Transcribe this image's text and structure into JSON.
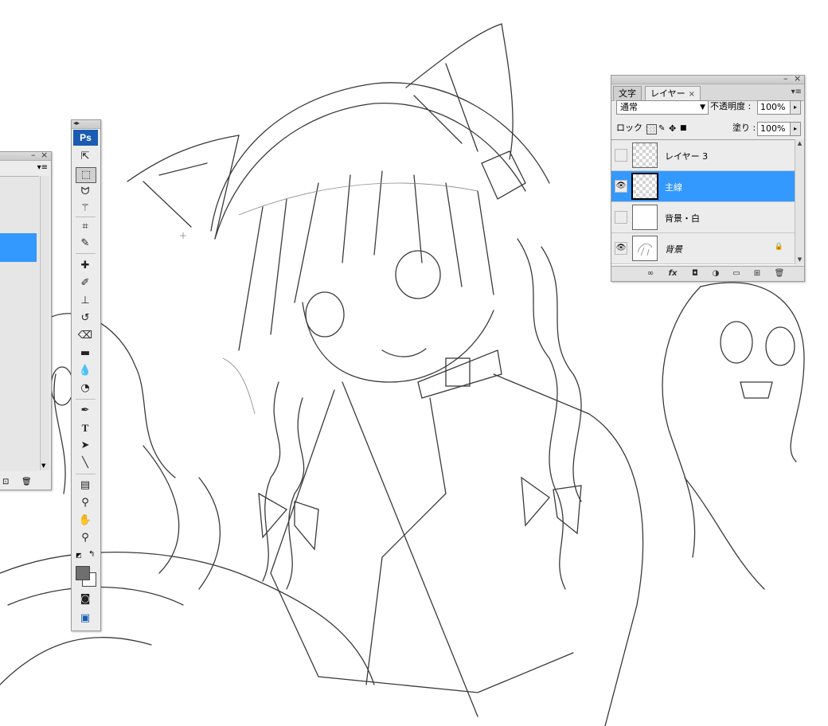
{
  "layers_panel": {
    "tabs": [
      "文字",
      "レイヤー"
    ],
    "active_tab": 1,
    "collapse_glyph": "«",
    "close_glyph": "×",
    "blend_mode": "通常",
    "opacity_label": "不透明度 :",
    "opacity_value": "100%",
    "lock_label": "ロック :",
    "fill_label": "塗り :",
    "fill_value": "100%",
    "layers": [
      {
        "name": "レイヤー 3",
        "visible": false,
        "selected": false,
        "thumb": "transparent"
      },
      {
        "name": "主線",
        "visible": true,
        "selected": true,
        "thumb": "transparent"
      },
      {
        "name": "背景・白",
        "visible": false,
        "selected": false,
        "thumb": "white"
      },
      {
        "name": "背景",
        "visible": true,
        "selected": false,
        "thumb": "sketch",
        "locked": true,
        "italic": true
      }
    ],
    "bottom_icons": [
      "link-icon",
      "fx-icon",
      "mask-icon",
      "adjustment-icon",
      "group-folder-icon",
      "new-layer-icon",
      "trash-icon"
    ],
    "fx_label": "fx"
  },
  "tools_panel": {
    "logo": "Ps",
    "tools": [
      "move-tool-icon",
      "marquee-tool-icon",
      "lasso-tool-icon",
      "magic-wand-tool-icon",
      "crop-tool-icon",
      "slice-tool-icon",
      "healing-brush-icon",
      "brush-tool-icon",
      "clone-stamp-icon",
      "history-brush-icon",
      "eraser-tool-icon",
      "gradient-tool-icon",
      "blur-tool-icon",
      "dodge-tool-icon",
      "pen-tool-icon",
      "type-tool-icon",
      "path-select-icon",
      "line-tool-icon",
      "notes-tool-icon",
      "eyedropper-tool-icon",
      "hand-tool-icon",
      "zoom-tool-icon"
    ],
    "type_tool_glyph": "T",
    "foreground_color": "#6f6f6f",
    "background_color": "#ffffff"
  },
  "colors": {
    "selection": "#3399ff",
    "panel_bg": "#ececec",
    "ps_logo": "#1b5cb2"
  }
}
